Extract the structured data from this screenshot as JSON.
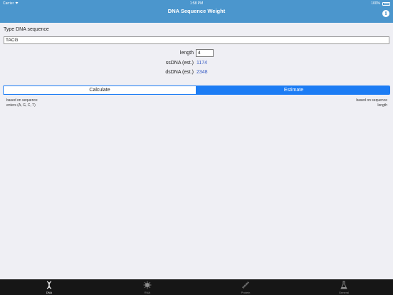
{
  "status_bar": {
    "carrier": "Carrier",
    "time": "1:58 PM",
    "battery": "100%"
  },
  "navbar": {
    "title": "DNA Sequence Weight"
  },
  "form": {
    "sequence_label": "Type DNA sequence",
    "sequence_value": "TACG",
    "length_label": "length",
    "length_value": "4",
    "ss_label": "ssDNA (est.)",
    "ss_value": "1174",
    "ds_label": "dsDNA (est.)",
    "ds_value": "2348"
  },
  "segmented": {
    "calculate": "Calculate",
    "estimate": "Estimate",
    "selected": "Estimate"
  },
  "hints": {
    "left_line1": "based on sequence",
    "left_line2": "enters (A, G, C, T)",
    "right_line1": "based on sequence",
    "right_line2": "length"
  },
  "tabs": [
    {
      "label": "DNA",
      "icon": "dna-icon",
      "active": true
    },
    {
      "label": "RNA",
      "icon": "rna-icon",
      "active": false
    },
    {
      "label": "Protein",
      "icon": "protein-icon",
      "active": false
    },
    {
      "label": "General",
      "icon": "flask-icon",
      "active": false
    }
  ],
  "colors": {
    "nav": "#4b96cd",
    "accent": "#1c7cf4",
    "value": "#3b5fc4",
    "tabbar": "#161616"
  }
}
